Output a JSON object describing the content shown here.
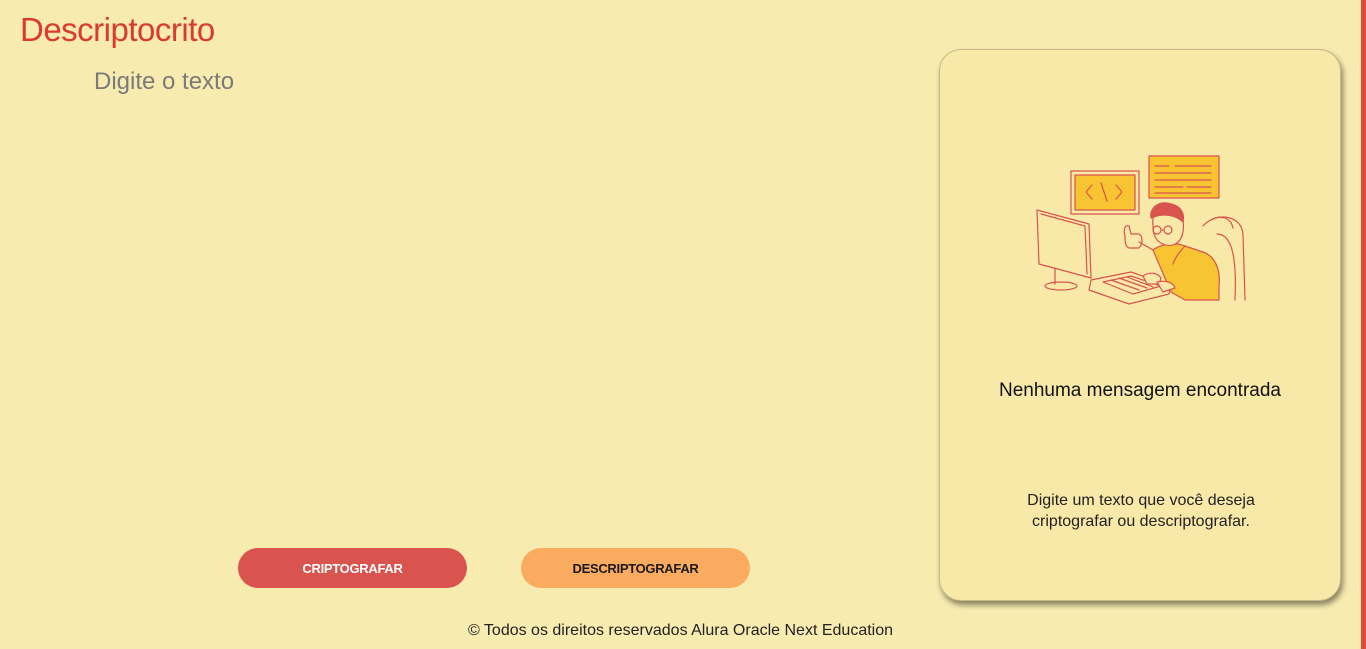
{
  "header": {
    "logo_text": "Descriptocrito"
  },
  "input": {
    "placeholder": "Digite o texto",
    "value": ""
  },
  "buttons": {
    "encrypt_label": "CRIPTOGRAFAR",
    "decrypt_label": "DESCRIPTOGRAFAR"
  },
  "output_card": {
    "illustration": "person-coding-illustration",
    "title": "Nenhuma mensagem encontrada",
    "description": "Digite um texto que você deseja criptografar ou descriptografar."
  },
  "footer": {
    "text": "© Todos os direitos reservados Alura Oracle Next Education"
  },
  "colors": {
    "background": "#f8ebb0",
    "accent_red": "#d93b2d",
    "encrypt_button": "#d9534f",
    "decrypt_button": "#fbab60",
    "card_background": "#f8e9a8",
    "illustration_yellow": "#f8c432",
    "illustration_line": "#d9534f"
  }
}
